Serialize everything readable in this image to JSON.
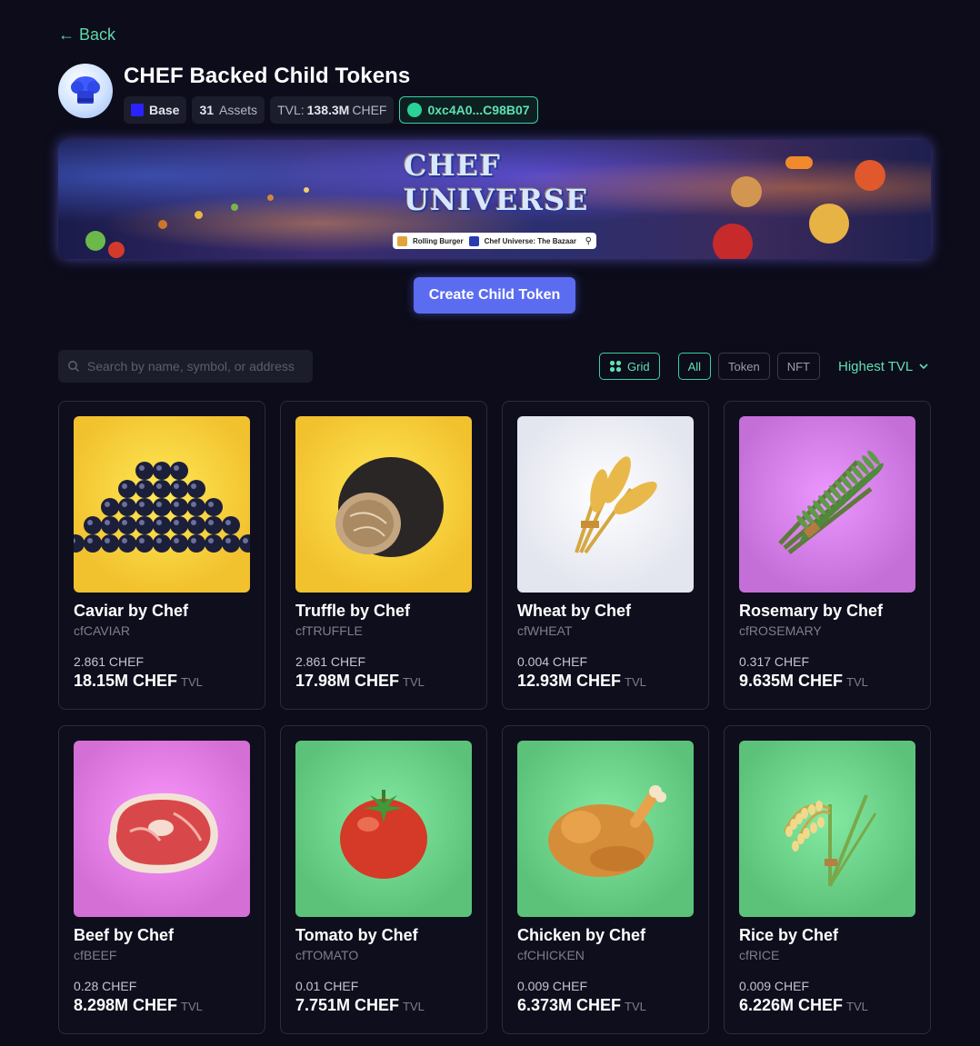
{
  "nav": {
    "back_label": "← Back"
  },
  "header": {
    "title": "CHEF Backed Child Tokens",
    "chain": "Base",
    "assets_count": "31",
    "assets_label": "Assets",
    "tvl_label": "TVL:",
    "tvl_value": "138.3M",
    "tvl_unit": "CHEF",
    "address": "0xc4A0...C98B07"
  },
  "banner": {
    "logo_text": "CHEF UNIVERSE",
    "link1": "Rolling Burger",
    "link2": "Chef Universe: The Bazaar"
  },
  "actions": {
    "create_label": "Create Child Token"
  },
  "filters": {
    "search_placeholder": "Search by name, symbol, or address",
    "view_label": "Grid",
    "all_label": "All",
    "token_label": "Token",
    "nft_label": "NFT",
    "sort_label": "Highest TVL"
  },
  "tvl_suffix": "TVL",
  "cards": [
    {
      "name": "Caviar by Chef",
      "symbol": "cfCAVIAR",
      "price": "2.861 CHEF",
      "tvl": "18.15M CHEF",
      "bg": "#f2c12e",
      "icon": "caviar-icon"
    },
    {
      "name": "Truffle by Chef",
      "symbol": "cfTRUFFLE",
      "price": "2.861 CHEF",
      "tvl": "17.98M CHEF",
      "bg": "#f2c12e",
      "icon": "truffle-icon"
    },
    {
      "name": "Wheat by Chef",
      "symbol": "cfWHEAT",
      "price": "0.004 CHEF",
      "tvl": "12.93M CHEF",
      "bg": "#e3e5ef",
      "icon": "wheat-icon"
    },
    {
      "name": "Rosemary by Chef",
      "symbol": "cfROSEMARY",
      "price": "0.317 CHEF",
      "tvl": "9.635M CHEF",
      "bg": "#c46ed8",
      "icon": "rosemary-icon"
    },
    {
      "name": "Beef by Chef",
      "symbol": "cfBEEF",
      "price": "0.28 CHEF",
      "tvl": "8.298M CHEF",
      "bg": "#d46fd6",
      "icon": "steak-icon"
    },
    {
      "name": "Tomato by Chef",
      "symbol": "cfTOMATO",
      "price": "0.01 CHEF",
      "tvl": "7.751M CHEF",
      "bg": "#5cc27a",
      "icon": "tomato-icon"
    },
    {
      "name": "Chicken by Chef",
      "symbol": "cfCHICKEN",
      "price": "0.009 CHEF",
      "tvl": "6.373M CHEF",
      "bg": "#5cc27a",
      "icon": "chicken-icon"
    },
    {
      "name": "Rice by Chef",
      "symbol": "cfRICE",
      "price": "0.009 CHEF",
      "tvl": "6.226M CHEF",
      "bg": "#5cc27a",
      "icon": "rice-icon"
    }
  ]
}
